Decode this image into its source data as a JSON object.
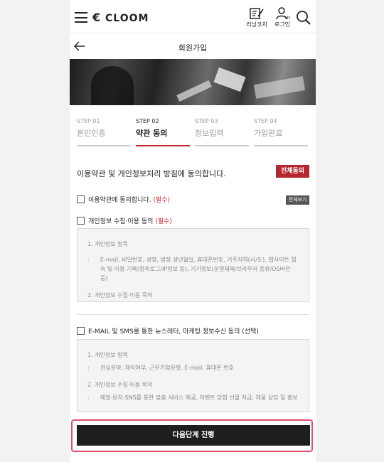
{
  "app": {
    "brand": "CLOOM",
    "menu_icon": "hamburger-icon",
    "nav": [
      {
        "label": "러닝코치",
        "icon": "clipboard-pencil-icon"
      },
      {
        "label": "로그인",
        "icon": "user-icon"
      }
    ],
    "search_icon": "search-icon"
  },
  "header": {
    "title": "회원가입",
    "back_icon": "arrow-left-icon"
  },
  "steps": [
    {
      "num": "STEP 01",
      "name": "본인인증",
      "active": false
    },
    {
      "num": "STEP 02",
      "name": "약관 동의",
      "active": true
    },
    {
      "num": "STEP 03",
      "name": "정보입력",
      "active": false
    },
    {
      "num": "STEP 04",
      "name": "가입완료",
      "active": false
    }
  ],
  "agreement": {
    "heading": "이용약관 및 개인정보처리 방침에 동의합니다.",
    "agree_all_label": "전체동의",
    "terms": {
      "label": "이용약관에 동의합니다.",
      "required": "(필수)",
      "view_label": "전체보기"
    },
    "privacy": {
      "label": "개인정보 수집·이용 동의",
      "required": "(필수)",
      "section1_title": "1. 개인정보 항목",
      "section1_text": "E-mail, 비밀번호, 성명, 법정 생년월일, 휴대폰번호, 거주지역(시/도), 웹사이트 접속 및 이용 기록(접속로그/IP정보 등), 기기정보(운영체제/브라우저 종류/OS버전 등)",
      "section2_title": "2. 개인정보 수집·이용 목적"
    },
    "marketing": {
      "label": "E-MAIL 및 SMS를 통한 뉴스레터, 마케팅 정보수신 동의",
      "optional": "(선택)",
      "section1_title": "1. 개인정보 항목",
      "section1_text": "관심분야, 재직여부, 근무기업유형, E-mail, 휴대폰 번호",
      "section2_title": "2. 개인정보 수집·이용 목적",
      "section2_text": "메일·문자·SNS를 통한 맞춤 서비스 제공, 이벤트 당첨 선물 지급, 제품 상담 및 홍보"
    }
  },
  "footer": {
    "next_label": "다음단계 진행"
  },
  "colors": {
    "accent": "#b5262e",
    "dark_button": "#1e1e1e",
    "highlight_outline": "#e0506a"
  }
}
